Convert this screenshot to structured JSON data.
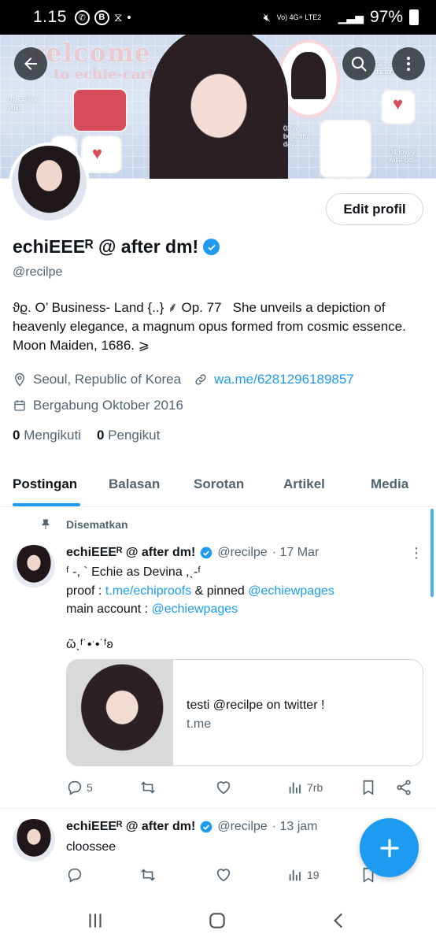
{
  "status_bar": {
    "time": "1.15",
    "network_labels": "Vo) 4G+ LTE2",
    "battery": "97%"
  },
  "banner": {
    "welcome": "welcome",
    "subtitle": "to echie-cart",
    "captions": [
      "01 sajarik yuki",
      "02 nisan saliro sam dadam",
      "03 a beautiful day",
      "04 lovey wille dollie"
    ]
  },
  "profile": {
    "edit_button": "Edit profil",
    "display_name": "echiEEEᴿ @ after dm!",
    "handle": "@recilpe",
    "bio": "ϑϱ. O’ Business- Land {..} ⸙ Op. 77   She unveils a depiction of heavenly elegance, a magnum opus formed from cosmic essence. Moon Maiden, 1686. ⩾",
    "location": "Seoul, Republic of Korea",
    "website": "wa.me/6281296189857",
    "joined": "Bergabung Oktober 2016",
    "following_count": "0",
    "following_label": "Mengikuti",
    "followers_count": "0",
    "followers_label": "Pengikut"
  },
  "tabs": [
    "Postingan",
    "Balasan",
    "Sorotan",
    "Artikel",
    "Media"
  ],
  "pinned_label": "Disematkan",
  "posts": [
    {
      "name": "echiEEEᴿ @ after dm!",
      "handle": "@recilpe",
      "time": "· 17 Mar",
      "line1": "ᶠ -, ` Echie as Devina ,ˎ-ᶠ",
      "line2_prefix": "proof : ",
      "line2_link": "t.me/echiproofs",
      "line2_mid": " & pinned ",
      "line2_link2": "@echiewpages",
      "line3_prefix": "main account : ",
      "line3_link": "@echiewpages",
      "line4": "ῶˎᶠ˙•ˑ•˙ᶠʚ ",
      "card_title": "testi @recilpe on twitter !",
      "card_domain": "t.me",
      "replies": "5",
      "views": "7rb"
    },
    {
      "name": "echiEEEᴿ @ after dm!",
      "handle": "@recilpe",
      "time": "· 13 jam",
      "text": "cloossee",
      "views": "19"
    }
  ],
  "colors": {
    "accent": "#1d9bf0",
    "text": "#0f1419",
    "muted": "#536471",
    "border": "#cfd9de"
  }
}
